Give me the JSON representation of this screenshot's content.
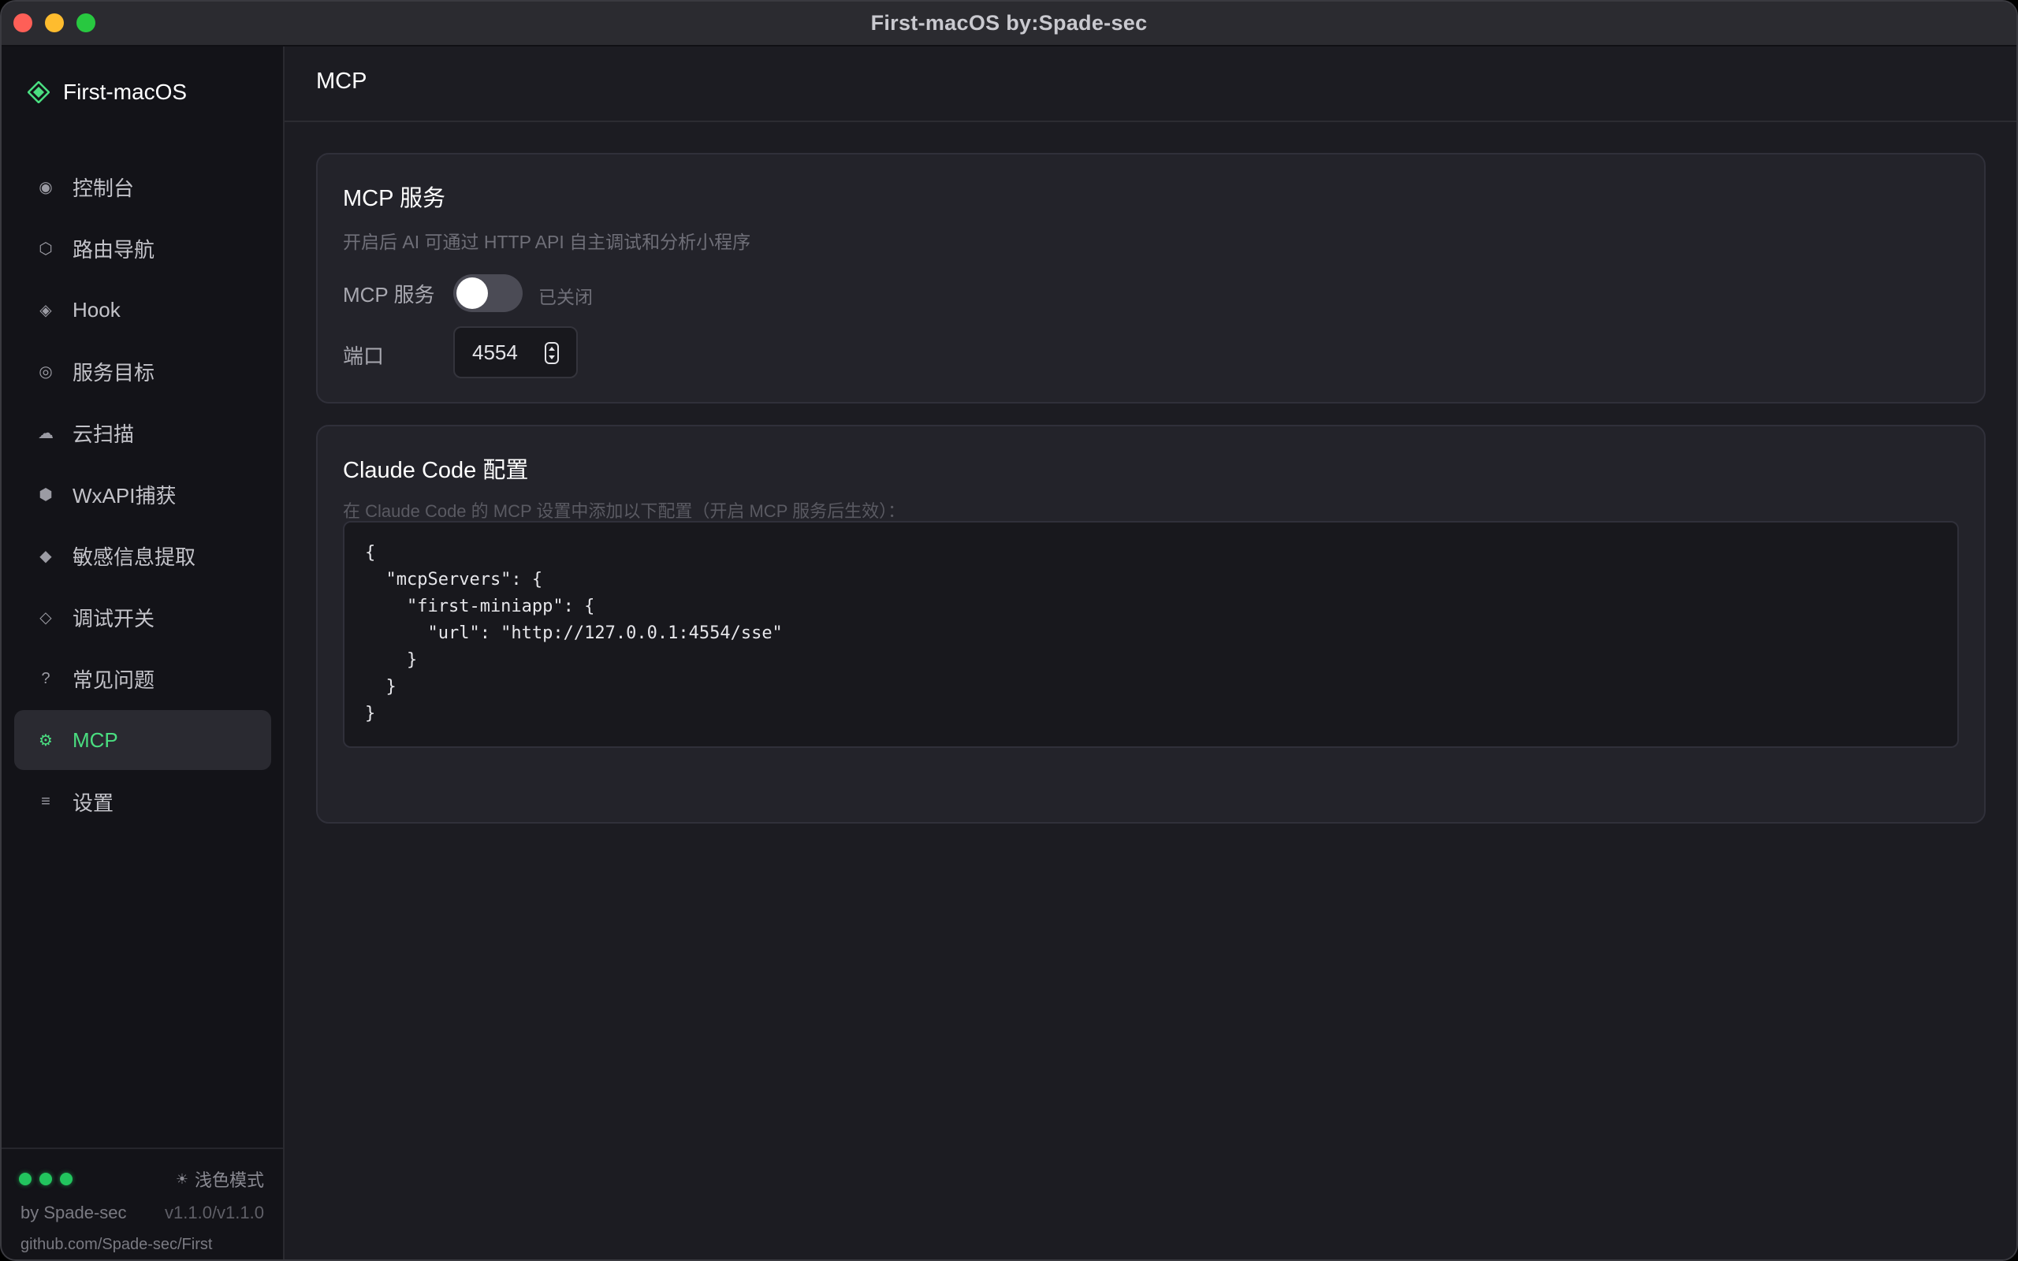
{
  "window": {
    "title": "First-macOS  by:Spade-sec"
  },
  "sidebar": {
    "brand": "First-macOS",
    "items": [
      {
        "label": "控制台",
        "icon": "◉"
      },
      {
        "label": "路由导航",
        "icon": "⬡"
      },
      {
        "label": "Hook",
        "icon": "◈"
      },
      {
        "label": "服务目标",
        "icon": "◎"
      },
      {
        "label": "云扫描",
        "icon": "☁"
      },
      {
        "label": "WxAPI捕获",
        "icon": "⬢"
      },
      {
        "label": "敏感信息提取",
        "icon": "◆"
      },
      {
        "label": "调试开关",
        "icon": "◇"
      },
      {
        "label": "常见问题",
        "icon": "?"
      },
      {
        "label": "MCP",
        "icon": "⚙"
      },
      {
        "label": "设置",
        "icon": "≡"
      }
    ],
    "active_item": "MCP",
    "footer": {
      "light_mode": "浅色模式",
      "by": "by Spade-sec",
      "version": "v1.1.0/v1.1.0",
      "repo": "github.com/Spade-sec/First"
    }
  },
  "main": {
    "page_title": "MCP",
    "mcp_card": {
      "title": "MCP 服务",
      "description": "开启后 AI 可通过 HTTP API 自主调试和分析小程序",
      "service_label": "MCP 服务",
      "service_enabled": false,
      "service_state": "已关闭",
      "port_label": "端口",
      "port_value": "4554"
    },
    "claude_card": {
      "title": "Claude Code 配置",
      "description": "在 Claude Code 的 MCP 设置中添加以下配置（开启 MCP 服务后生效）：",
      "config": "{\n  \"mcpServers\": {\n    \"first-miniapp\": {\n      \"url\": \"http://127.0.0.1:4554/sse\"\n    }\n  }\n}"
    }
  },
  "colors": {
    "accent": "#4ade80",
    "background": "#1c1c22",
    "sidebar": "#131318",
    "card": "#23232a"
  }
}
